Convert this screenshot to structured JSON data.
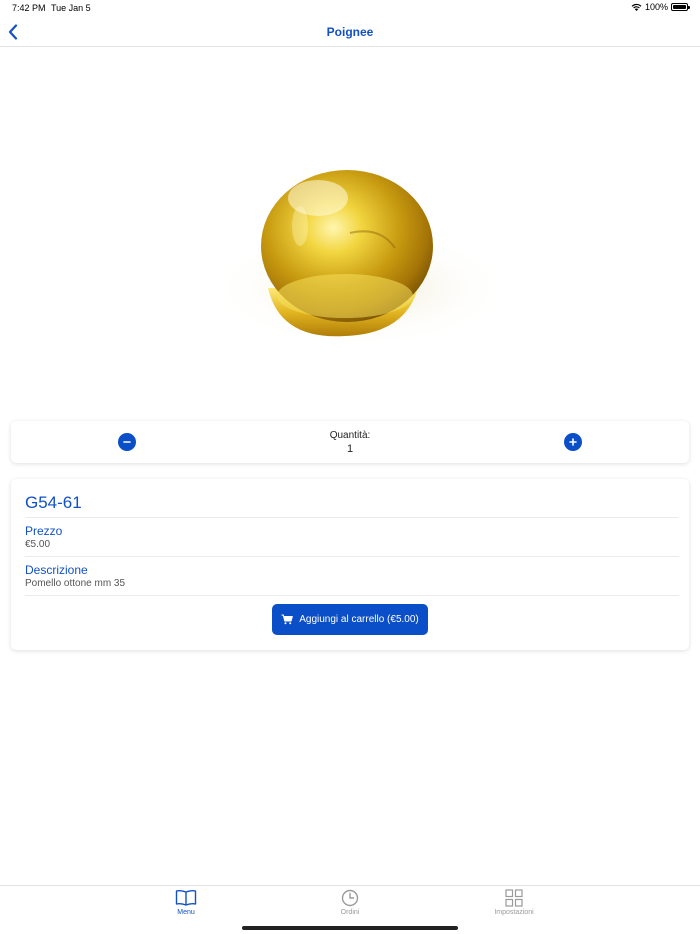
{
  "status_bar": {
    "time": "7:42 PM",
    "date": "Tue Jan 5",
    "battery": "100%"
  },
  "nav": {
    "title": "Poignee",
    "back_icon": "chevron-left-icon"
  },
  "product_image": {
    "description_icon": "brass-knob-image"
  },
  "quantity": {
    "label": "Quantità:",
    "value": "1"
  },
  "product": {
    "sku": "G54-61",
    "price_label": "Prezzo",
    "price_value": "€5.00",
    "description_label": "Descrizione",
    "description_value": "Pomello ottone mm 35",
    "add_to_cart_label": "Aggiungi al carrello (€5.00)"
  },
  "tab_bar": {
    "items": [
      {
        "label": "Menu",
        "icon": "book-icon",
        "active": true
      },
      {
        "label": "Ordini",
        "icon": "clock-icon",
        "active": false
      },
      {
        "label": "Impostazioni",
        "icon": "grid-icon",
        "active": false
      }
    ]
  },
  "colors": {
    "accent": "#1151c5",
    "button": "#0a4fc8",
    "inactive": "#9a9a9a"
  }
}
